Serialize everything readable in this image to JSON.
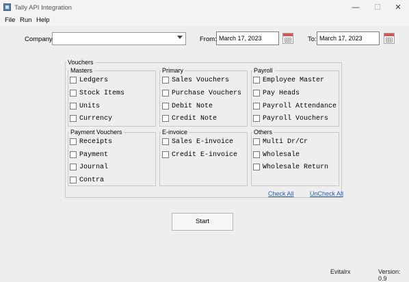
{
  "window": {
    "title": "Tally API Integration",
    "minimize": "—",
    "maximize": "☐",
    "close": "✕"
  },
  "menu": [
    "File",
    "Run",
    "Help"
  ],
  "filters": {
    "company_label": "Company:",
    "company_value": "",
    "from_label": "From:",
    "from_date": "March 17, 2023",
    "to_label": "To:",
    "to_date": "March 17, 2023"
  },
  "vouchers": {
    "title": "Vouchers",
    "groups": [
      {
        "title": "Masters",
        "items": [
          "Ledgers",
          "Stock Items",
          "Units",
          "Currency"
        ]
      },
      {
        "title": "Primary",
        "items": [
          "Sales Vouchers",
          "Purchase Vouchers",
          "Debit Note",
          "Credit Note"
        ]
      },
      {
        "title": "Payroll",
        "items": [
          "Employee Master",
          "Pay Heads",
          "Payroll Attendance",
          "Payroll Vouchers"
        ]
      },
      {
        "title": "Payment Vouchers",
        "items": [
          "Receipts",
          "Payment",
          "Journal",
          "Contra"
        ]
      },
      {
        "title": "E-invoice",
        "items": [
          "Sales E-invoice",
          "Credit E-invoice"
        ]
      },
      {
        "title": "Others",
        "items": [
          "Multi Dr/Cr",
          "Wholesale",
          "Wholesale Return"
        ]
      }
    ],
    "check_all": "Check All",
    "uncheck_all": "UnCheck All"
  },
  "actions": {
    "start": "Start"
  },
  "status": {
    "brand": "Evitalrx",
    "version": "Version: 0.9"
  }
}
